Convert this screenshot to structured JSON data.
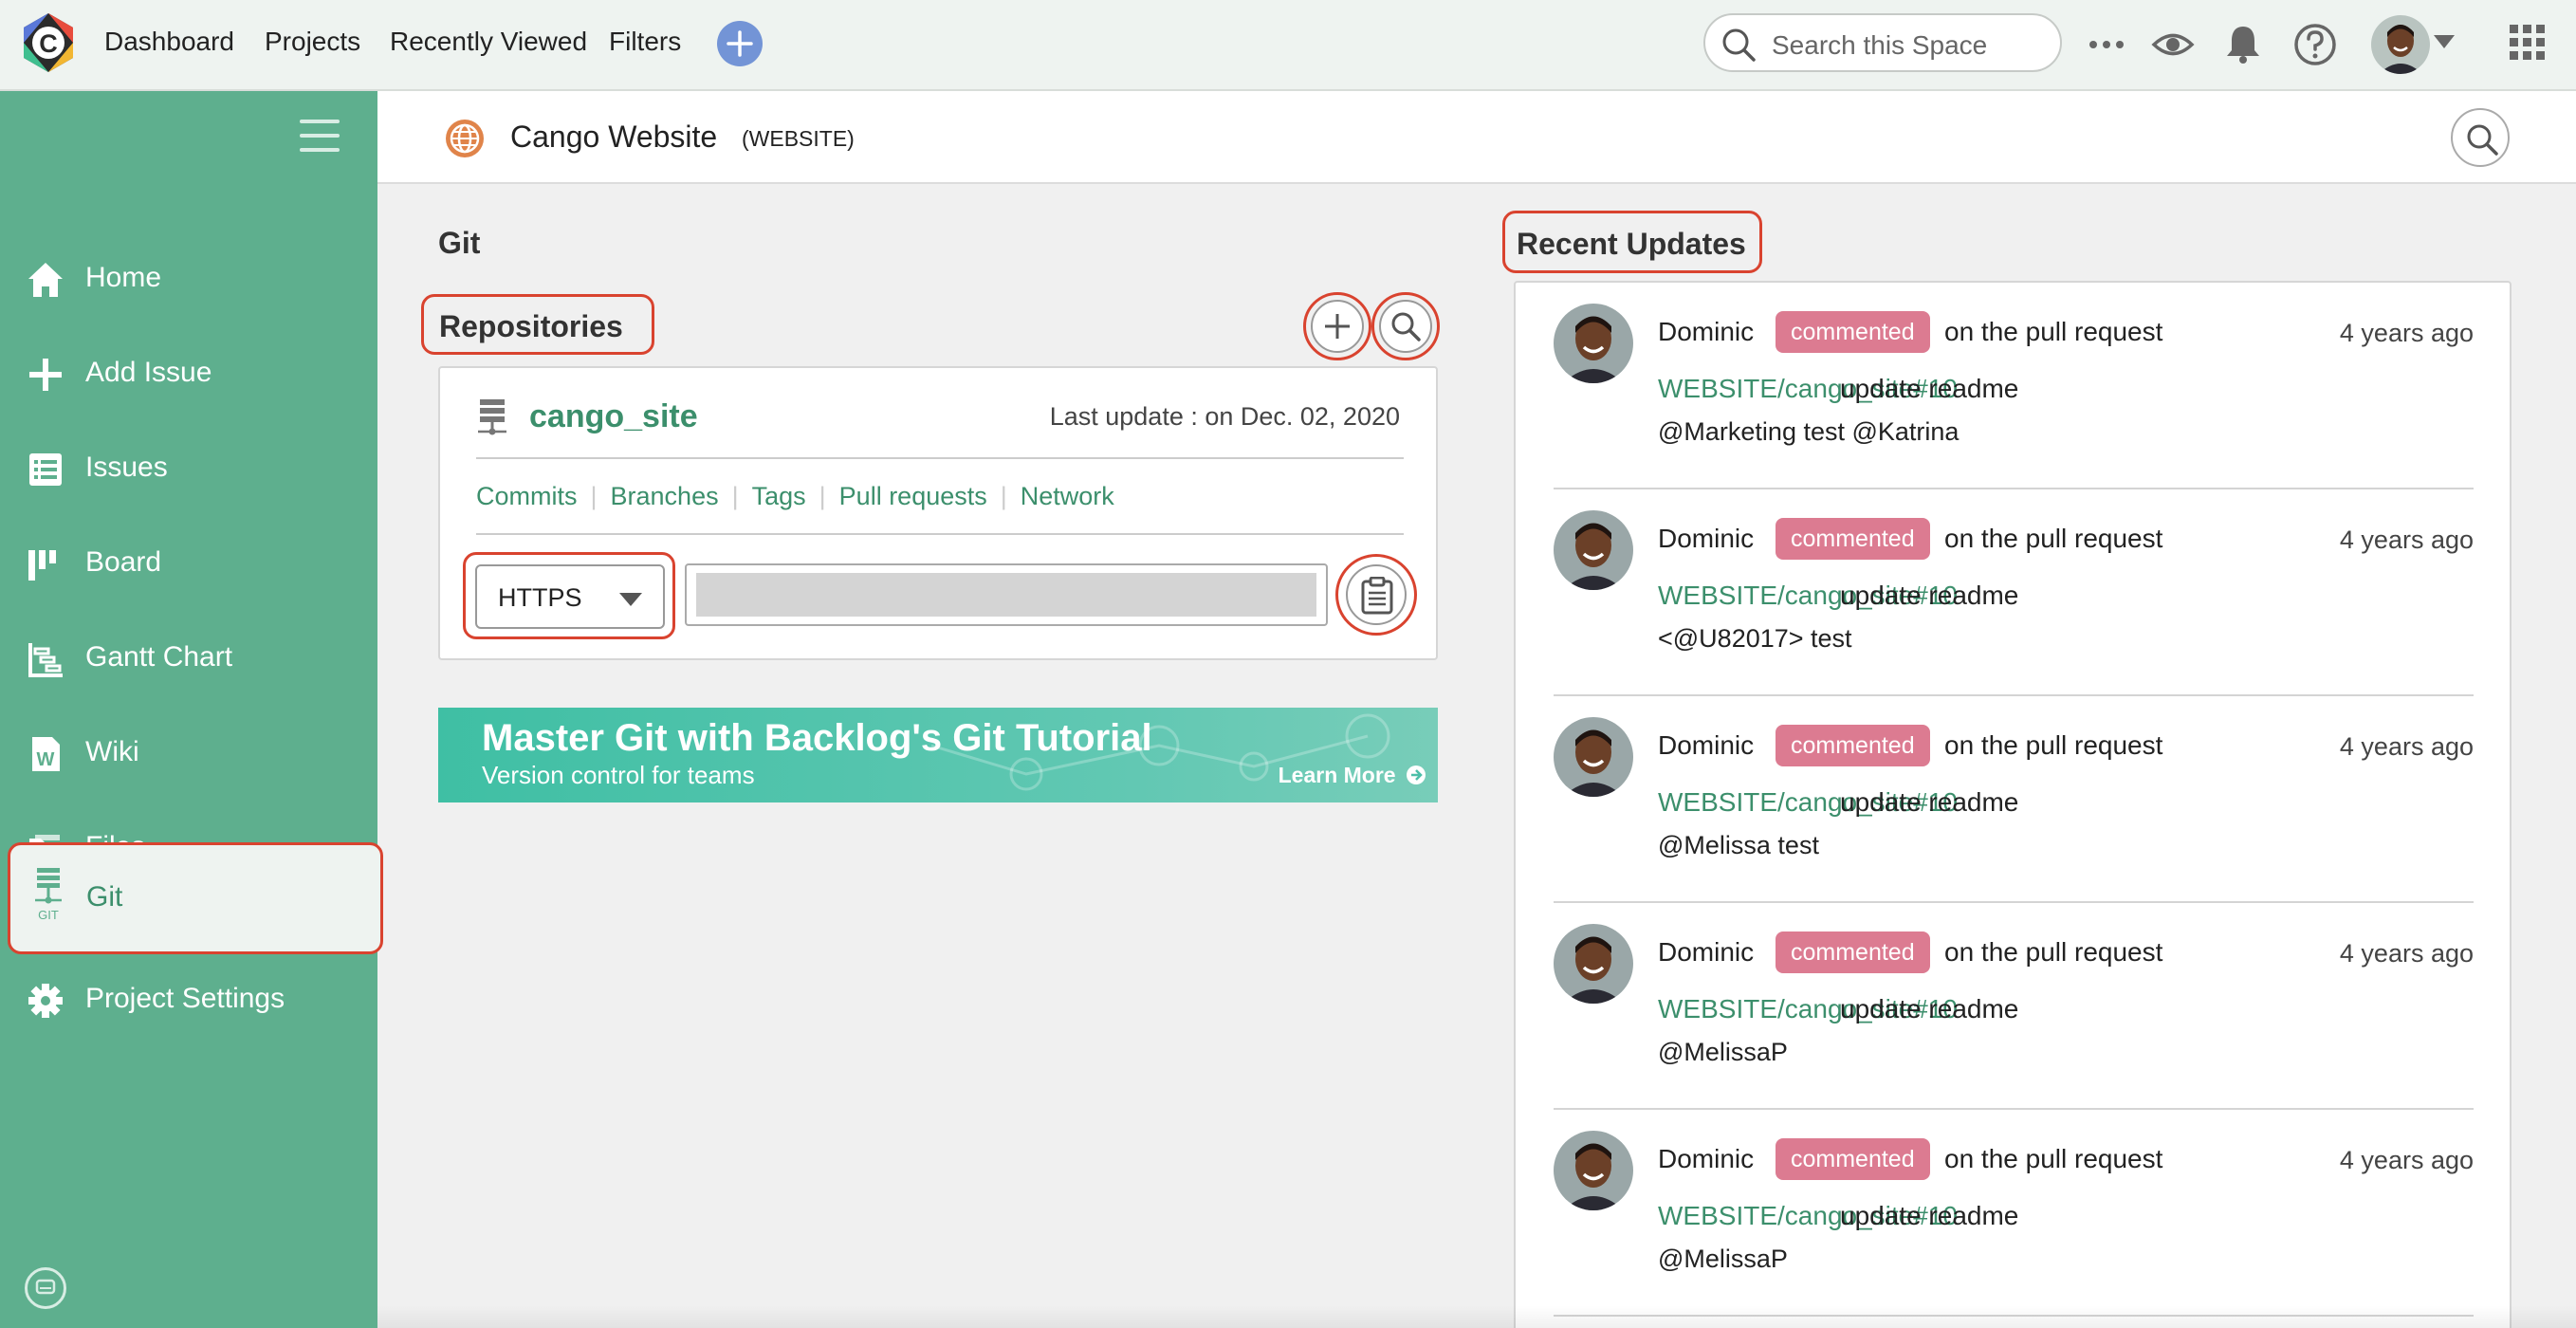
{
  "topbar": {
    "logo_letter": "C",
    "nav": [
      "Dashboard",
      "Projects",
      "Recently Viewed",
      "Filters"
    ],
    "search_placeholder": "Search this Space"
  },
  "sidebar": {
    "items": [
      {
        "label": "Home",
        "icon": "home-icon"
      },
      {
        "label": "Add Issue",
        "icon": "plus-icon"
      },
      {
        "label": "Issues",
        "icon": "list-icon"
      },
      {
        "label": "Board",
        "icon": "board-icon"
      },
      {
        "label": "Gantt Chart",
        "icon": "gantt-icon"
      },
      {
        "label": "Wiki",
        "icon": "wiki-icon"
      },
      {
        "label": "Files",
        "icon": "folder-icon"
      },
      {
        "label": "Git",
        "icon": "git-icon",
        "icon_caption": "GIT",
        "active": true
      },
      {
        "label": "Project Settings",
        "icon": "gear-icon"
      }
    ]
  },
  "header": {
    "project_name": "Cango Website",
    "project_key": "(WEBSITE)"
  },
  "main": {
    "page_title": "Git",
    "repositories_heading": "Repositories",
    "repo": {
      "name": "cango_site",
      "last_update": "Last update : on Dec. 02, 2020",
      "links": [
        "Commits",
        "Branches",
        "Tags",
        "Pull requests",
        "Network"
      ],
      "protocol": "HTTPS"
    },
    "banner": {
      "title": "Master Git with Backlog's Git Tutorial",
      "subtitle": "Version control for teams",
      "cta": "Learn More"
    }
  },
  "updates": {
    "heading": "Recent Updates",
    "items": [
      {
        "user": "Dominic",
        "badge": "commented",
        "action": "on the pull request",
        "time": "4 years ago",
        "link": "WEBSITE/cango_site#10",
        "title": "update readme",
        "comment": "@Marketing test @Katrina"
      },
      {
        "user": "Dominic",
        "badge": "commented",
        "action": "on the pull request",
        "time": "4 years ago",
        "link": "WEBSITE/cango_site#10",
        "title": "update readme",
        "comment": "<@U82017> test"
      },
      {
        "user": "Dominic",
        "badge": "commented",
        "action": "on the pull request",
        "time": "4 years ago",
        "link": "WEBSITE/cango_site#10",
        "title": "update readme",
        "comment": "@Melissa test"
      },
      {
        "user": "Dominic",
        "badge": "commented",
        "action": "on the pull request",
        "time": "4 years ago",
        "link": "WEBSITE/cango_site#10",
        "title": "update readme",
        "comment": "@MelissaP"
      },
      {
        "user": "Dominic",
        "badge": "commented",
        "action": "on the pull request",
        "time": "4 years ago",
        "link": "WEBSITE/cango_site#10",
        "title": "update readme",
        "comment": "@MelissaP"
      }
    ]
  },
  "colors": {
    "sidebar": "#5eaf8e",
    "accent_green": "#3c8f6c",
    "highlight_red": "#d9432f",
    "badge_pink": "#dc7b91"
  }
}
